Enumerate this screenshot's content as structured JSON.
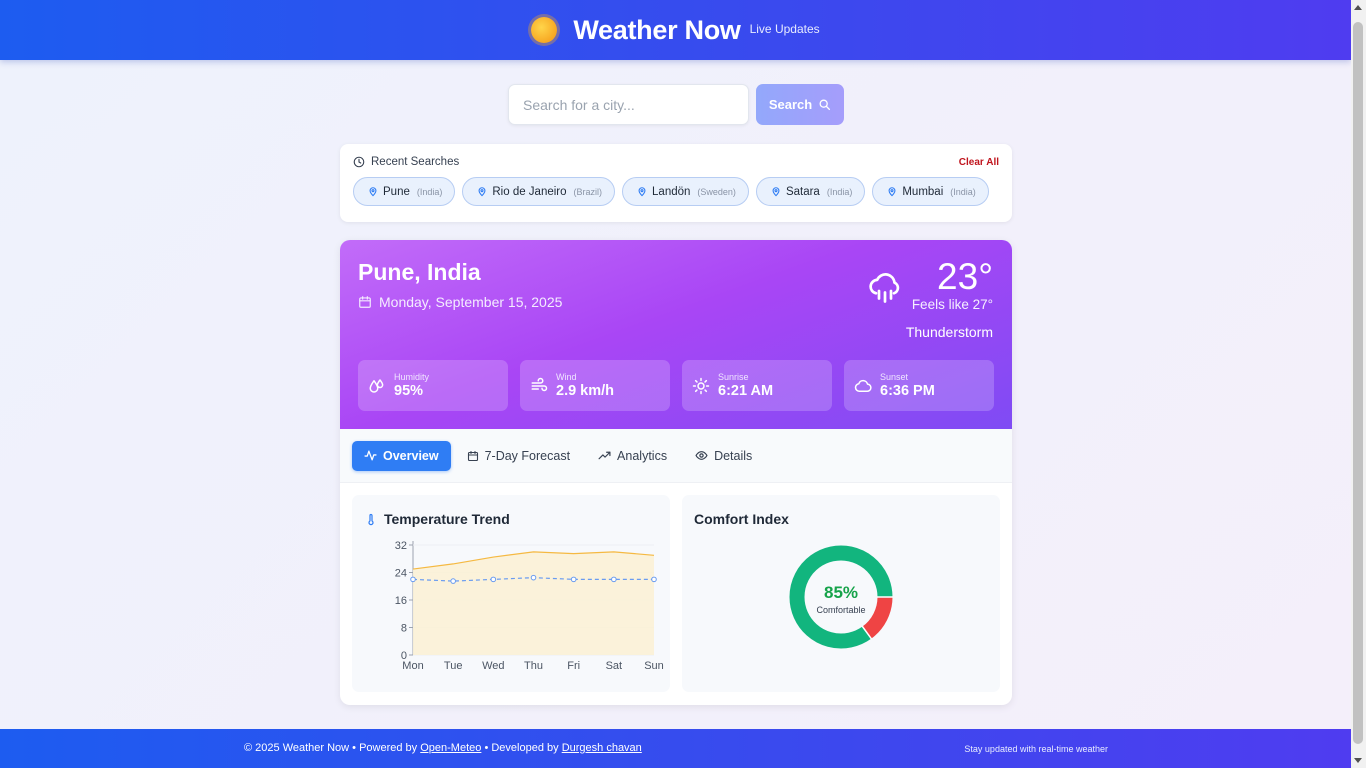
{
  "header": {
    "title": "Weather Now",
    "tag": "Live Updates"
  },
  "search": {
    "placeholder": "Search for a city...",
    "button": "Search"
  },
  "recent": {
    "title": "Recent Searches",
    "clear": "Clear All",
    "items": [
      {
        "city": "Pune",
        "country": "(India)"
      },
      {
        "city": "Rio de Janeiro",
        "country": "(Brazil)"
      },
      {
        "city": "Landön",
        "country": "(Sweden)"
      },
      {
        "city": "Satara",
        "country": "(India)"
      },
      {
        "city": "Mumbai",
        "country": "(India)"
      }
    ]
  },
  "weather": {
    "city": "Pune, India",
    "date": "Monday, September 15, 2025",
    "temp": "23°",
    "feels": "Feels like 27°",
    "condition": "Thunderstorm",
    "icon": "cloud-rain-icon",
    "stats": [
      {
        "label": "Humidity",
        "value": "95%",
        "icon": "droplets-icon"
      },
      {
        "label": "Wind",
        "value": "2.9 km/h",
        "icon": "wind-icon"
      },
      {
        "label": "Sunrise",
        "value": "6:21 AM",
        "icon": "sun-icon"
      },
      {
        "label": "Sunset",
        "value": "6:36 PM",
        "icon": "cloud-icon"
      }
    ]
  },
  "tabs": [
    {
      "label": "Overview",
      "icon": "activity-icon",
      "active": true
    },
    {
      "label": "7-Day Forecast",
      "icon": "calendar-icon",
      "active": false
    },
    {
      "label": "Analytics",
      "icon": "trending-up-icon",
      "active": false
    },
    {
      "label": "Details",
      "icon": "eye-icon",
      "active": false
    }
  ],
  "temperature_panel": {
    "title": "Temperature Trend"
  },
  "comfort_panel": {
    "title": "Comfort Index",
    "percent": "85%",
    "label": "Comfortable",
    "value": 85
  },
  "chart_data": {
    "type": "area",
    "title": "Temperature Trend",
    "categories": [
      "Mon",
      "Tue",
      "Wed",
      "Thu",
      "Fri",
      "Sat",
      "Sun"
    ],
    "series": [
      {
        "values": [
          25,
          26.5,
          28.5,
          30,
          29.5,
          30,
          29
        ],
        "color": "#f5b942"
      },
      {
        "values": [
          22,
          21.5,
          22,
          22.5,
          22,
          22,
          22
        ],
        "color": "#6a9cf0"
      }
    ],
    "yticks": [
      0,
      8,
      16,
      24,
      32
    ],
    "ylim": [
      0,
      32
    ]
  },
  "colors": {
    "accent": "#2f7df4",
    "comfort_good": "#12b57e",
    "comfort_bad": "#ef4444"
  },
  "footer": {
    "copy": "© 2025 Weather Now • Powered by ",
    "link1": "Open-Meteo",
    "mid": " • Developed by ",
    "link2": "Durgesh chavan",
    "tagline": "Stay updated with real-time weather"
  }
}
